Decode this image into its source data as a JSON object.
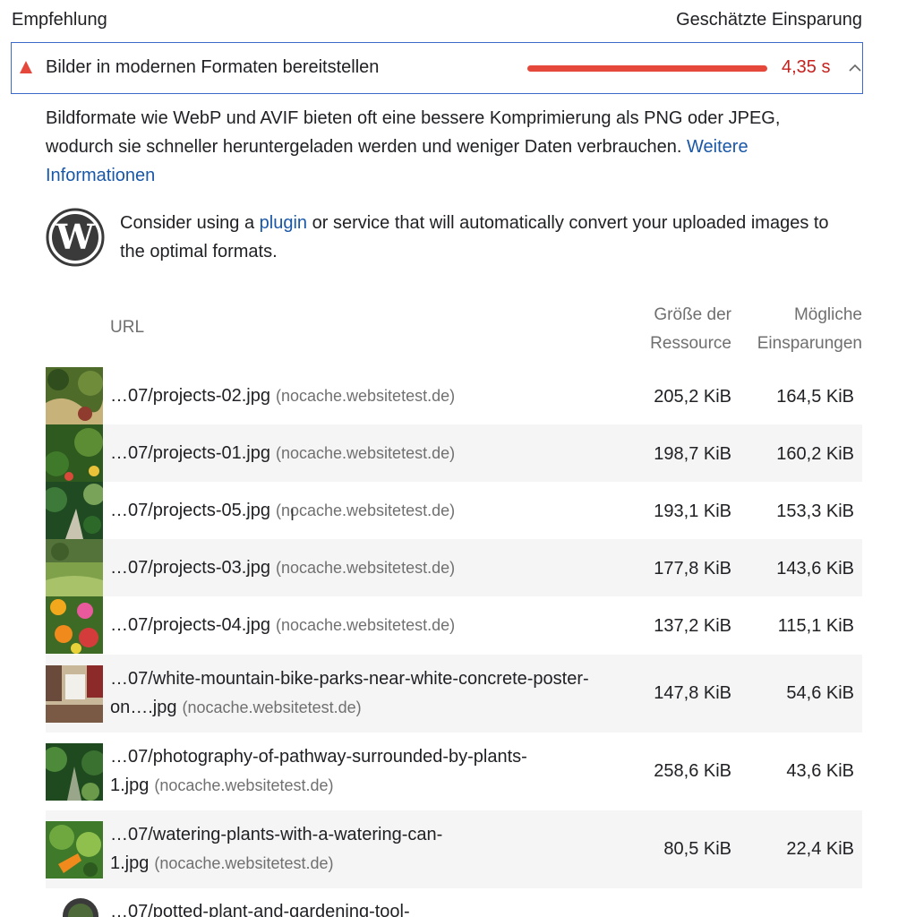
{
  "header": {
    "left": "Empfehlung",
    "right": "Geschätzte Einsparung"
  },
  "audit": {
    "title": "Bilder in modernen Formaten bereitstellen",
    "savings": "4,35 s",
    "severity_color": "#e5473b",
    "savings_color": "#c5221f"
  },
  "description": {
    "text": "Bildformate wie WebP und AVIF bieten oft eine bessere Komprimierung als PNG oder JPEG, wodurch sie schneller heruntergeladen werden und weniger Daten verbrauchen.",
    "link": "Weitere Informationen"
  },
  "wordpress": {
    "before": "Consider using a",
    "link": "plugin",
    "after": "or service that will automatically convert your uploaded images to the optimal formats."
  },
  "table": {
    "col_url": "URL",
    "col_size": [
      "Größe der",
      "Ressource"
    ],
    "col_savings": [
      "Mögliche",
      "Einsparungen"
    ],
    "rows": [
      {
        "url": "…07/projects-02.jpg",
        "host": "(nocache.websitetest.de)",
        "size": "205,2 KiB",
        "savings": "164,5 KiB"
      },
      {
        "url": "…07/projects-01.jpg",
        "host": "(nocache.websitetest.de)",
        "size": "198,7 KiB",
        "savings": "160,2 KiB"
      },
      {
        "url": "…07/projects-05.jpg",
        "host": "(nocache.websitetest.de)",
        "size": "193,1 KiB",
        "savings": "153,3 KiB"
      },
      {
        "url": "…07/projects-03.jpg",
        "host": "(nocache.websitetest.de)",
        "size": "177,8 KiB",
        "savings": "143,6 KiB"
      },
      {
        "url": "…07/projects-04.jpg",
        "host": "(nocache.websitetest.de)",
        "size": "137,2 KiB",
        "savings": "115,1 KiB"
      },
      {
        "url1": "…07/white-mountain-bike-parks-near-white-concrete-poster-",
        "url2": "on….jpg",
        "host": "(nocache.websitetest.de)",
        "size": "147,8 KiB",
        "savings": "54,6 KiB"
      },
      {
        "url1": "…07/photography-of-pathway-surrounded-by-plants-",
        "url2": "1.jpg",
        "host": "(nocache.websitetest.de)",
        "size": "258,6 KiB",
        "savings": "43,6 KiB"
      },
      {
        "url1": "…07/watering-plants-with-a-watering-can-",
        "url2": "1.jpg",
        "host": "(nocache.websitetest.de)",
        "size": "80,5 KiB",
        "savings": "22,4 KiB"
      },
      {
        "url1": "…07/potted-plant-and-gardening-tool-"
      }
    ]
  }
}
